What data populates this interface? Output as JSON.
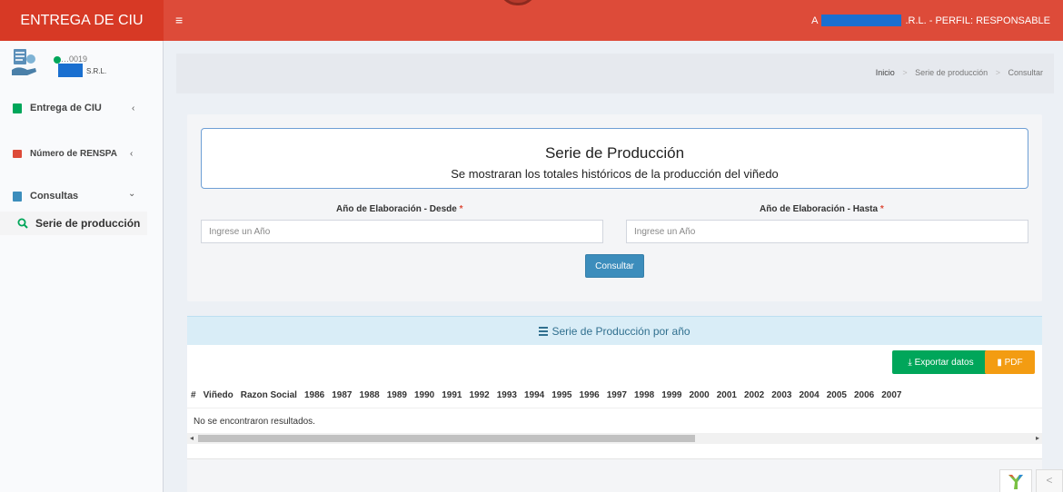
{
  "header": {
    "brand": "ENTREGA DE CIU",
    "menu_icon": "≡",
    "user_prefix": "A",
    "user_suffix": ".R.L. - PERFIL: RESPONSABLE"
  },
  "sidebar": {
    "user_id": "…0019",
    "company_suffix": "S.R.L.",
    "items": [
      {
        "label": "Entrega de CIU",
        "chevron": "‹",
        "icon_color": "#00a65a"
      },
      {
        "label": "Número de RENSPA",
        "chevron": "‹",
        "icon_color": "#dd4b39"
      },
      {
        "label": "Consultas",
        "chevron": "⌄",
        "icon_color": "#3c8dbc"
      }
    ],
    "submenu": [
      {
        "label": "Serie de producción",
        "icon": "search-icon"
      }
    ]
  },
  "breadcrumb": [
    "Inicio",
    "Serie de producción",
    "Consultar"
  ],
  "form": {
    "title": "Serie de Producción",
    "subtitle": "Se mostraran los totales históricos de la producción del viñedo",
    "desde_label": "Año de Elaboración - Desde",
    "hasta_label": "Año de Elaboración - Hasta",
    "required_mark": "*",
    "desde_placeholder": "Ingrese un Año",
    "hasta_placeholder": "Ingrese un Año",
    "submit_label": "Consultar"
  },
  "results": {
    "title": "Serie de Producción por año",
    "export_label": "Exportar datos",
    "pdf_label": "PDF",
    "columns": [
      "#",
      "Viñedo",
      "Razon Social",
      "1986",
      "1987",
      "1988",
      "1989",
      "1990",
      "1991",
      "1992",
      "1993",
      "1994",
      "1995",
      "1996",
      "1997",
      "1998",
      "1999",
      "2000",
      "2001",
      "2002",
      "2003",
      "2004",
      "2005",
      "2006",
      "2007"
    ],
    "empty_message": "No se encontraron resultados."
  },
  "colors": {
    "header_red": "#dd4b39",
    "primary_blue": "#3c8dbc",
    "success_green": "#00a65a",
    "warning_orange": "#f39c12",
    "info_bg": "#d9edf7"
  }
}
